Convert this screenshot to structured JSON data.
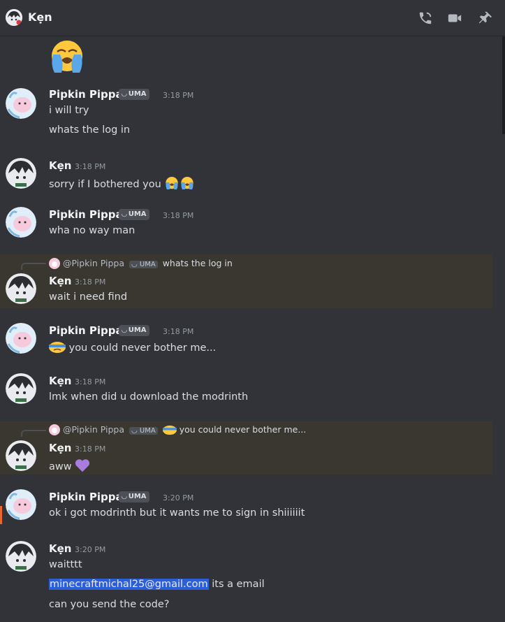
{
  "channel": {
    "title": "Kẹn"
  },
  "messages": [
    {
      "id": "m0",
      "continuation_emoji": "loudly-crying-emoji"
    },
    {
      "id": "m1",
      "author": "Pipkin Pippa",
      "tag": "UMA",
      "time": "3:18 PM",
      "lines": [
        "i will try",
        "whats the log in"
      ]
    },
    {
      "id": "m2",
      "author": "Kẹn",
      "time": "3:18 PM",
      "lines": [
        "sorry if I bothered you"
      ]
    },
    {
      "id": "m3",
      "author": "Pipkin Pippa",
      "tag": "UMA",
      "time": "3:18 PM",
      "lines": [
        "wha no way man"
      ]
    },
    {
      "id": "m4",
      "reply": {
        "user": "@Pipkin Pippa",
        "tag": "UMA",
        "text": "whats the log in"
      },
      "author": "Kẹn",
      "time": "3:18 PM",
      "lines": [
        "wait i need find"
      ]
    },
    {
      "id": "m5",
      "author": "Pipkin Pippa",
      "tag": "UMA",
      "time": "3:18 PM",
      "lines": [
        "you could never bother me..."
      ]
    },
    {
      "id": "m6",
      "author": "Kẹn",
      "time": "3:18 PM",
      "lines": [
        "lmk when did u download the modrinth"
      ]
    },
    {
      "id": "m7",
      "reply": {
        "user": "@Pipkin Pippa",
        "tag": "UMA",
        "text": "you could never bother me..."
      },
      "author": "Kẹn",
      "time": "3:18 PM",
      "lines": [
        "aww"
      ]
    },
    {
      "id": "m8",
      "author": "Pipkin Pippa",
      "tag": "UMA",
      "time": "3:20 PM",
      "lines": [
        "ok i got modrinth but it wants me to sign in shiiiiiit"
      ]
    },
    {
      "id": "m9",
      "author": "Kẹn",
      "time": "3:20 PM",
      "lines": [
        "waitttt",
        "its a email",
        "can you send the code?"
      ],
      "email": "minecraftmichal25@gmail.com"
    }
  ],
  "icons": {
    "call": "phone-call-icon",
    "video": "video-camera-icon",
    "pin": "pin-icon"
  },
  "colors": {
    "background": "#313338",
    "reply_highlight": "#3a3730",
    "selection": "#2b5fd9",
    "heart": "#a97cdf"
  }
}
